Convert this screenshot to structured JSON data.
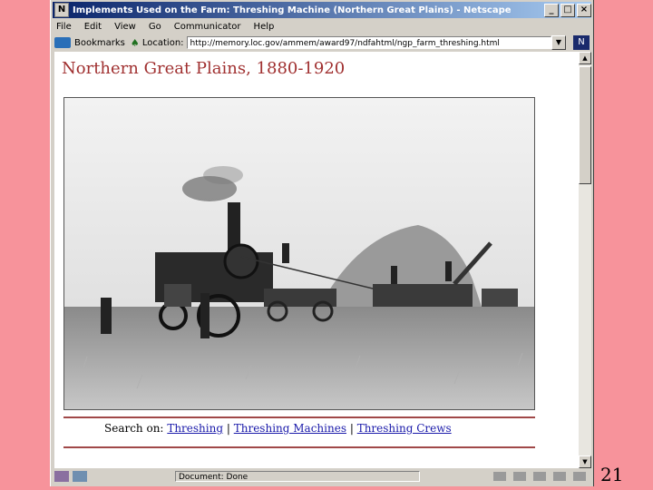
{
  "window": {
    "title": "Implements Used on the Farm: Threshing Machine (Northern Great Plains) - Netscape",
    "app_icon": "netscape-icon"
  },
  "menu": [
    "File",
    "Edit",
    "View",
    "Go",
    "Communicator",
    "Help"
  ],
  "toolbar": {
    "bookmarks_label": "Bookmarks",
    "location_label": "Location:",
    "url": "http://memory.loc.gov/ammem/award97/ndfahtml/ngp_farm_threshing.html"
  },
  "page": {
    "title": "Northern Great Plains, 1880-1920",
    "search_prefix": "Search on:",
    "links": [
      "Threshing",
      "Threshing Machines",
      "Threshing Crews"
    ],
    "separator": "|"
  },
  "status": {
    "text": "Document: Done"
  },
  "slide": {
    "page_number": "21"
  },
  "colors": {
    "slide_bg": "#f7939b",
    "title_bar": "#0a246a",
    "page_title": "#a03030",
    "link": "#1a1aaa"
  }
}
